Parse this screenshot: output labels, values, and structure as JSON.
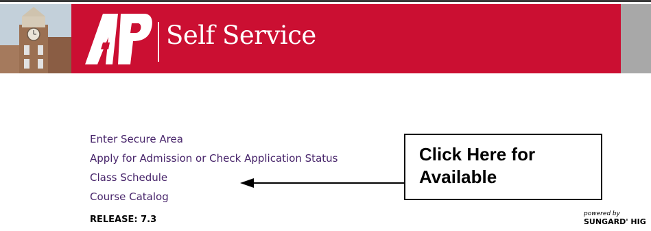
{
  "header": {
    "logo_text": "AP",
    "title": "Self Service",
    "colors": {
      "banner_red": "#cb0f32",
      "banner_gray": "#a8a8a8"
    }
  },
  "menu": {
    "items": [
      {
        "label": "Enter Secure Area"
      },
      {
        "label": "Apply for Admission or Check Application Status"
      },
      {
        "label": "Class Schedule"
      },
      {
        "label": "Course Catalog"
      }
    ],
    "link_color": "#47246a"
  },
  "footer": {
    "release": "RELEASE: 7.3",
    "powered_by": "powered by",
    "powered_brand": "SUNGARD' HIG"
  },
  "annotation": {
    "callout_text": "Click Here for\nAvailable",
    "arrow_icon": "left-arrow-icon"
  }
}
